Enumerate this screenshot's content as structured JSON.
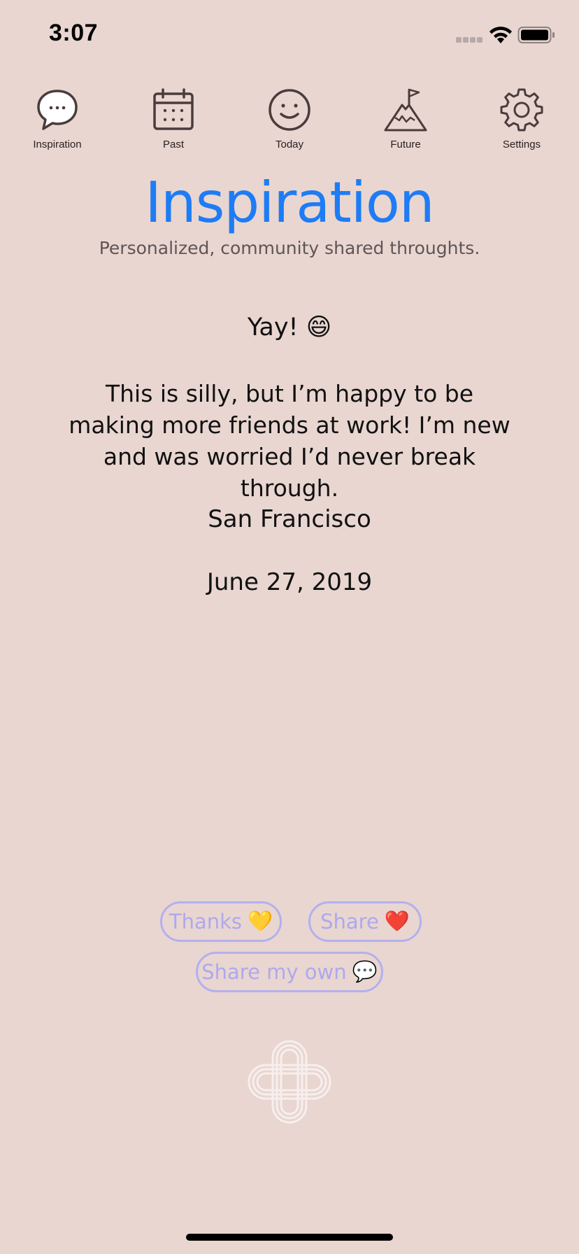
{
  "status_bar": {
    "time": "3:07",
    "signal_icon": "signal-dots-icon",
    "wifi_icon": "wifi-icon",
    "battery_icon": "battery-icon"
  },
  "nav": {
    "items": [
      {
        "label": "Inspiration",
        "icon": "chat-bubble-icon"
      },
      {
        "label": "Past",
        "icon": "calendar-icon"
      },
      {
        "label": "Today",
        "icon": "smiley-icon"
      },
      {
        "label": "Future",
        "icon": "mountain-flag-icon"
      },
      {
        "label": "Settings",
        "icon": "gear-icon"
      }
    ]
  },
  "header": {
    "title": "Inspiration",
    "subtitle": "Personalized, community shared throughts."
  },
  "post": {
    "heading": "Yay! 😄",
    "body": "This is silly, but I’m happy to be making more friends at work! I’m new and was worried I’d never break through.",
    "location": "San Francisco",
    "date": "June 27, 2019"
  },
  "actions": {
    "thanks_label": "Thanks",
    "thanks_emoji": "💛",
    "share_label": "Share",
    "share_emoji": "❤️",
    "share_own_label": "Share my own",
    "share_own_emoji": "💬"
  },
  "colors": {
    "background": "#e9d6d1",
    "title_blue": "#1e7cf5",
    "button_outline": "#b3b0ee",
    "icon_stroke": "#4a3c3c"
  },
  "logo_icon": "interlaced-knot-logo-icon"
}
